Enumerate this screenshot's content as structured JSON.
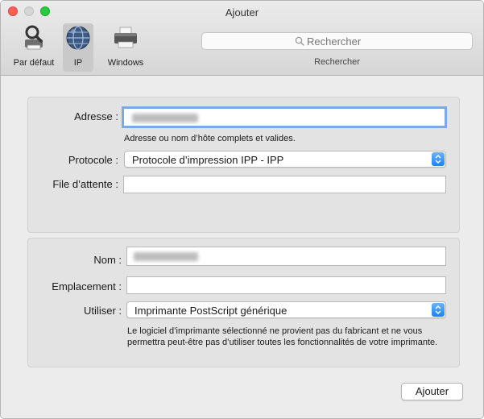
{
  "window": {
    "title": "Ajouter"
  },
  "toolbar": {
    "buttons": [
      {
        "label": "Par défaut",
        "icon": "default-printer-icon"
      },
      {
        "label": "IP",
        "icon": "globe-icon",
        "selected": true
      },
      {
        "label": "Windows",
        "icon": "windows-printer-icon"
      }
    ],
    "search": {
      "placeholder": "Rechercher",
      "caption": "Rechercher"
    }
  },
  "address_panel": {
    "address_label": "Adresse :",
    "address_value": "",
    "address_hint": "Adresse ou nom d’hôte complets et valides.",
    "protocol_label": "Protocole :",
    "protocol_value": "Protocole d’impression IPP - IPP",
    "queue_label": "File d’attente :",
    "queue_value": ""
  },
  "printer_panel": {
    "name_label": "Nom :",
    "name_value": "",
    "location_label": "Emplacement :",
    "location_value": "",
    "use_label": "Utiliser :",
    "use_value": "Imprimante PostScript générique",
    "driver_note": "Le logiciel d’imprimante sélectionné ne provient pas du fabricant et ne vous permettra peut-être pas d’utiliser toutes les fonctionnalités de votre imprimante."
  },
  "footer": {
    "add_button": "Ajouter"
  },
  "colors": {
    "accent": "#1a82fb",
    "focus_ring": "#7aa9e6",
    "close": "#fd5f57",
    "maximize": "#29c940"
  }
}
